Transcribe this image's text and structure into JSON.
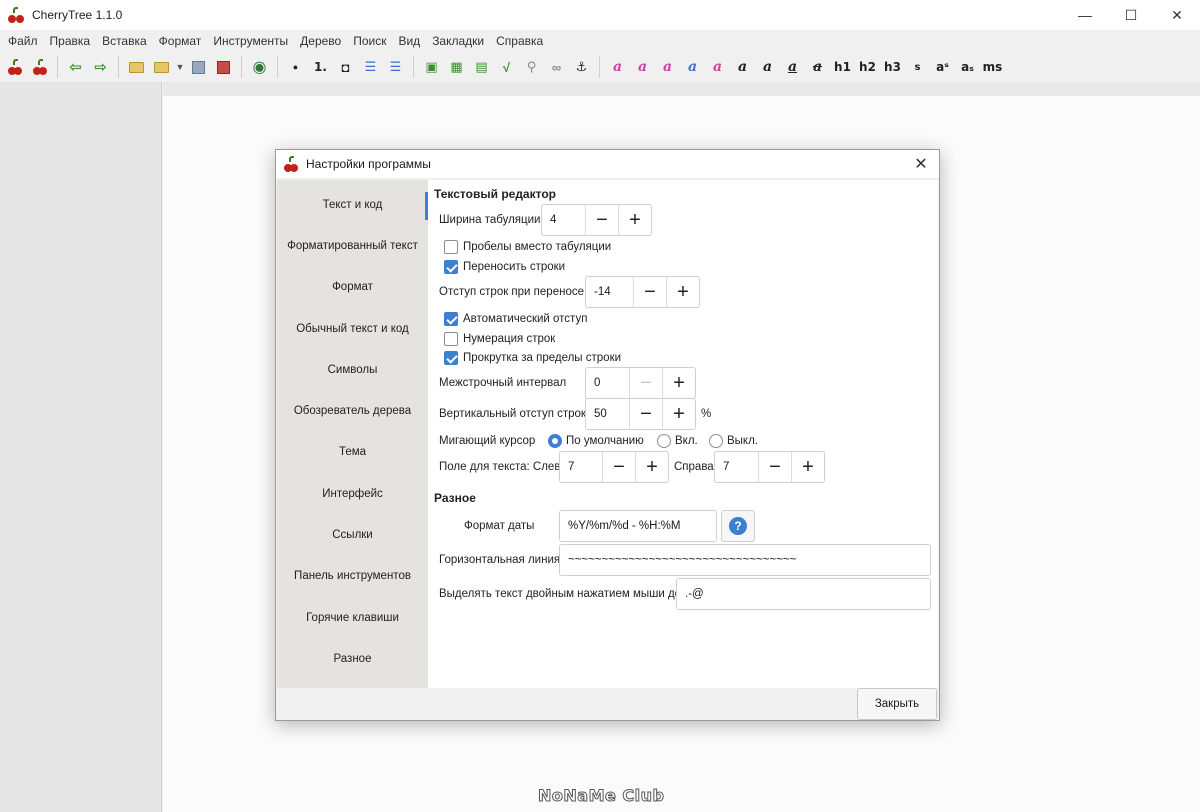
{
  "window": {
    "title": "CherryTree 1.1.0"
  },
  "menu": [
    "Файл",
    "Правка",
    "Вставка",
    "Формат",
    "Инструменты",
    "Дерево",
    "Поиск",
    "Вид",
    "Закладки",
    "Справка"
  ],
  "toolbar": {
    "h1": "h1",
    "h2": "h2",
    "h3": "h3",
    "small": "s",
    "sup": "aˢ",
    "sub": "aₛ",
    "mono": "ms",
    "bullet": "●",
    "numbered": "1.",
    "todo": "◘"
  },
  "dialog": {
    "title": "Настройки программы",
    "close_label": "Закрыть",
    "sidebar": [
      "Текст и код",
      "Форматированный текст",
      "Формат",
      "Обычный текст и код",
      "Символы",
      "Обозреватель дерева",
      "Тема",
      "Интерфейс",
      "Ссылки",
      "Панель инструментов",
      "Горячие клавиши",
      "Разное"
    ],
    "text_editor": {
      "heading": "Текстовый редактор",
      "tab_width_label": "Ширина табуляции",
      "tab_width": "4",
      "spaces_label": "Пробелы вместо табуляции",
      "wrap_label": "Переносить строки",
      "wrap_indent_label": "Отступ строк при переносе",
      "wrap_indent": "-14",
      "auto_indent_label": "Автоматический отступ",
      "line_numbers_label": "Нумерация строк",
      "scroll_label": "Прокрутка за пределы строки",
      "line_spacing_label": "Межстрочный интервал",
      "line_spacing": "0",
      "vert_margin_label": "Вертикальный отступ строк",
      "vert_margin": "50",
      "vert_margin_unit": "%",
      "cursor_label": "Мигающий курсор",
      "cursor_default": "По умолчанию",
      "cursor_on": "Вкл.",
      "cursor_off": "Выкл.",
      "margin_left_label": "Поле для текста: Слева",
      "margin_left": "7",
      "margin_right_label": "Справа",
      "margin_right": "7"
    },
    "misc": {
      "heading": "Разное",
      "date_format_label": "Формат даты",
      "date_format": "%Y/%m/%d - %H:%M",
      "hr_label": "Горизонтальная линия",
      "hr_value": "~~~~~~~~~~~~~~~~~~~~~~~~~~~~~~~~~~",
      "dblclick_label": "Выделять текст двойным нажатием мыши до",
      "dblclick_value": ".-@"
    }
  },
  "watermark": "NoNaMe Club",
  "colors": {
    "accent": "#3d7fd2",
    "cherry": "#c4201a"
  }
}
